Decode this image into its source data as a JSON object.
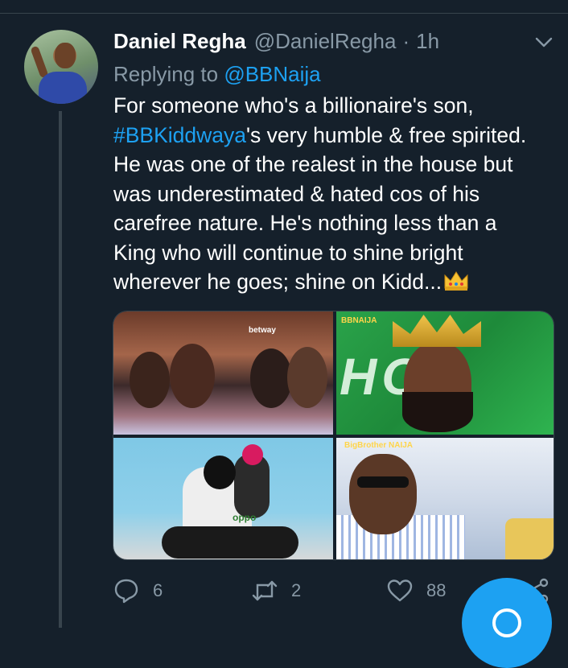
{
  "tweet": {
    "author": {
      "display_name": "Daniel Regha",
      "handle": "@DanielRegha",
      "separator": "·",
      "time": "1h"
    },
    "replying_prefix": "Replying to",
    "replying_to": "@BBNaija",
    "body": {
      "line1": "For someone who's a billionaire's son,",
      "hashtag": "#BBKiddwaya",
      "line2_rest": "'s very humble & free spirited.",
      "line3": "He was one of the realest in the house but",
      "line4": "was underestimated & hated cos of his",
      "line5": "carefree nature. He's nothing less than a",
      "line6": "King who will continue to shine bright",
      "line7": "wherever he goes; shine on Kidd...",
      "emoji": "crown-emoji"
    },
    "media": {
      "tile1_text": "betway",
      "tile2_text": "BBNAIJA",
      "tile3_text": "oppo",
      "tile4_text": "BigBrother NAIJA"
    },
    "actions": {
      "reply_count": "6",
      "retweet_count": "2",
      "like_count": "88"
    }
  },
  "colors": {
    "background": "#15202b",
    "accent": "#1da1f2",
    "secondary_text": "#8899a6",
    "divider": "#38444d"
  },
  "icons": [
    "chevron-down-icon",
    "reply-icon",
    "retweet-icon",
    "like-icon",
    "share-icon",
    "compose-icon"
  ]
}
